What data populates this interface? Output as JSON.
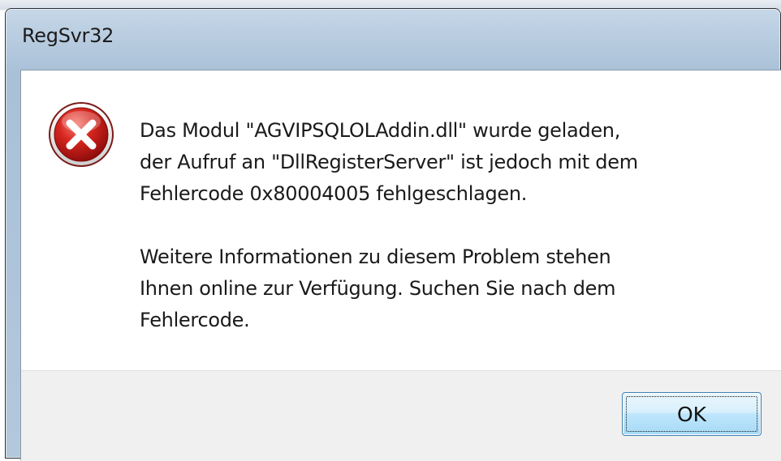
{
  "window": {
    "title": "RegSvr32"
  },
  "dialog": {
    "icon": "error-icon",
    "message_line1": "Das Modul \"AGVIPSQLOLAddin.dll\" wurde geladen,\nder Aufruf an \"DllRegisterServer\" ist jedoch mit dem\nFehlercode 0x80004005 fehlgeschlagen.",
    "message_line2": "Weitere Informationen zu diesem Problem stehen\nIhnen online zur Verfügung. Suchen Sie nach dem\nFehlercode.",
    "ok_label": "OK"
  },
  "colors": {
    "error_red": "#c8201e",
    "button_border": "#3c7fb1"
  }
}
